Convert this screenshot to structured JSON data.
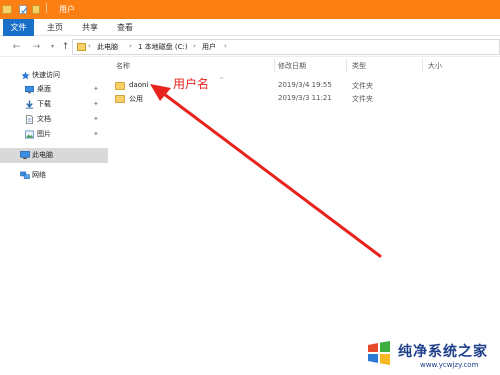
{
  "window": {
    "title": "用户"
  },
  "ribbon": {
    "tabs": [
      "文件",
      "主页",
      "共享",
      "查看"
    ]
  },
  "address": {
    "crumbs": [
      "此电脑",
      "1 本地磁盘 (C:)",
      "用户"
    ]
  },
  "sidebar": {
    "items": [
      {
        "label": "快速访问",
        "icon": "star-icon"
      },
      {
        "label": "桌面",
        "icon": "desktop-icon",
        "pinned": true
      },
      {
        "label": "下载",
        "icon": "download-icon",
        "pinned": true
      },
      {
        "label": "文档",
        "icon": "document-icon",
        "pinned": true
      },
      {
        "label": "图片",
        "icon": "picture-icon",
        "pinned": true
      },
      {
        "label": "此电脑",
        "icon": "computer-icon",
        "selected": true
      },
      {
        "label": "网络",
        "icon": "network-icon"
      }
    ]
  },
  "columns": {
    "name": "名称",
    "date": "修改日期",
    "type": "类型",
    "size": "大小"
  },
  "files": [
    {
      "name": "daoni",
      "date": "2019/3/4 19:55",
      "type": "文件夹"
    },
    {
      "name": "公用",
      "date": "2019/3/3 11:21",
      "type": "文件夹"
    }
  ],
  "annotation": {
    "label": "用户名",
    "color": "#e8231d"
  },
  "watermark": {
    "title": "纯净系统之家",
    "url": "www.ycwjzy.com"
  },
  "colors": {
    "titlebar": "#fc7f14",
    "file_tab": "#1a70c8",
    "selected": "#d9d9d9"
  }
}
